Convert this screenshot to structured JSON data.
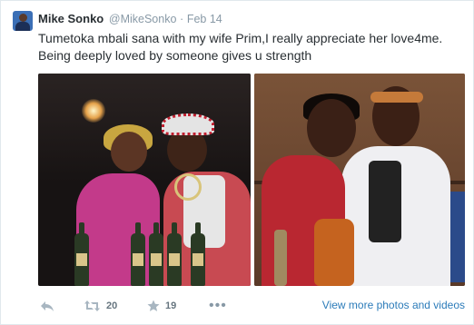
{
  "tweet": {
    "fullname": "Mike Sonko",
    "username": "@MikeSonko",
    "separator": "·",
    "date": "Feb 14",
    "text_lines": [
      "Tumetoka mbali sana with my wife Prim,I really appreciate her love4me.",
      "Being deeply loved by someone gives u strength"
    ]
  },
  "actions": {
    "reply_icon": "reply-icon",
    "retweet_icon": "retweet-icon",
    "retweet_count": "20",
    "favorite_icon": "star-icon",
    "favorite_count": "19",
    "more_icon": "more-icon",
    "more_label": "•••",
    "view_more_label": "View more photos and videos"
  },
  "colors": {
    "link": "#2b7bb9",
    "muted": "#8899a6",
    "text": "#292f33"
  }
}
